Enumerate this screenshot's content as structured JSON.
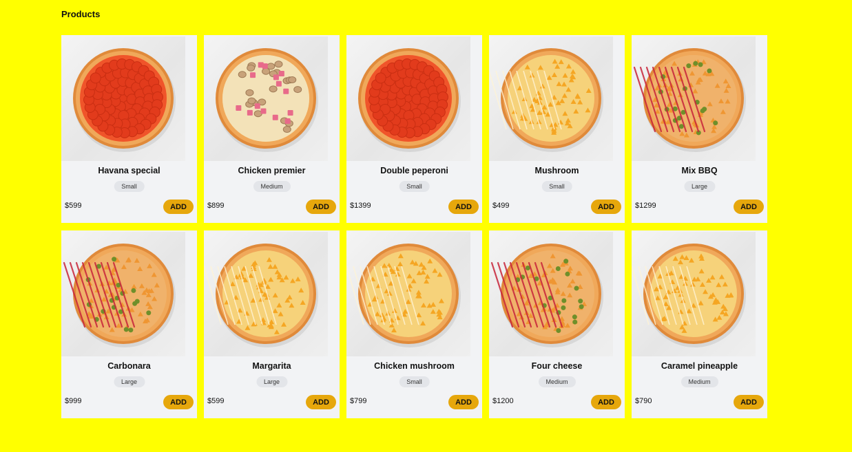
{
  "page": {
    "title": "Products"
  },
  "colors": {
    "background": "#ffff00",
    "card": "#f2f3f5",
    "button": "#e6a70c",
    "badge": "#e3e5e9"
  },
  "add_label": "ADD",
  "products": [
    {
      "name": "Havana special",
      "size": "Small",
      "price": "$599",
      "image": "pepperoni-pizza-image"
    },
    {
      "name": "Chicken premier",
      "size": "Medium",
      "price": "$899",
      "image": "ham-mushroom-pizza-image"
    },
    {
      "name": "Double peperoni",
      "size": "Small",
      "price": "$1399",
      "image": "pepperoni-pizza-image"
    },
    {
      "name": "Mushroom",
      "size": "Small",
      "price": "$499",
      "image": "cheese-pizza-image"
    },
    {
      "name": "Mix BBQ",
      "size": "Large",
      "price": "$1299",
      "image": "bbq-pizza-image"
    },
    {
      "name": "Carbonara",
      "size": "Large",
      "price": "$999",
      "image": "bbq-pizza-image"
    },
    {
      "name": "Margarita",
      "size": "Large",
      "price": "$599",
      "image": "cheese-pizza-image"
    },
    {
      "name": "Chicken mushroom",
      "size": "Small",
      "price": "$799",
      "image": "cheese-pizza-image"
    },
    {
      "name": "Four cheese",
      "size": "Medium",
      "price": "$1200",
      "image": "bbq-pizza-image"
    },
    {
      "name": "Caramel pineapple",
      "size": "Medium",
      "price": "$790",
      "image": "cheese-pizza-image"
    }
  ]
}
